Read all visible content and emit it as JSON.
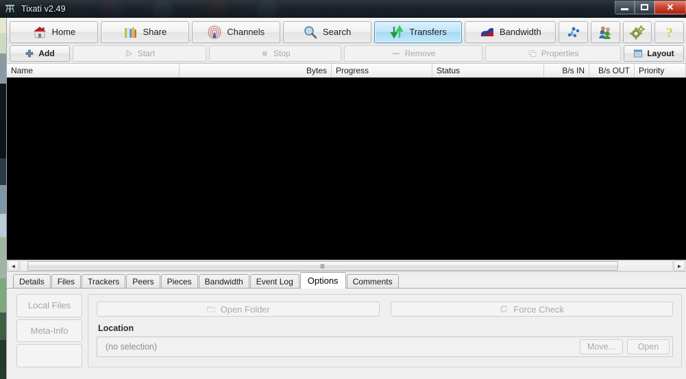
{
  "window": {
    "title": "Tixati v2.49",
    "app_icon": "tixati-logo-icon",
    "controls": {
      "minimize": "–",
      "maximize": "□",
      "close": "✕"
    }
  },
  "main_toolbar": {
    "items": [
      {
        "label": "Home",
        "icon": "house-icon",
        "selected": false
      },
      {
        "label": "Share",
        "icon": "books-icon",
        "selected": false
      },
      {
        "label": "Channels",
        "icon": "antenna-icon",
        "selected": false
      },
      {
        "label": "Search",
        "icon": "magnifier-icon",
        "selected": false
      },
      {
        "label": "Transfers",
        "icon": "up-down-arrows-icon",
        "selected": true
      },
      {
        "label": "Bandwidth",
        "icon": "wave-graph-icon",
        "selected": false
      }
    ],
    "icon_buttons": [
      {
        "icon": "network-nodes-icon",
        "label": ""
      },
      {
        "icon": "peers-people-icon",
        "label": ""
      },
      {
        "icon": "gears-settings-icon",
        "label": ""
      },
      {
        "icon": "question-mark-help-icon",
        "label": ""
      }
    ]
  },
  "action_bar": {
    "buttons": [
      {
        "label": "Add",
        "icon": "plus-icon",
        "enabled": true
      },
      {
        "label": "Start",
        "icon": "play-triangle-icon",
        "enabled": false
      },
      {
        "label": "Stop",
        "icon": "stop-square-icon",
        "enabled": false
      },
      {
        "label": "Remove",
        "icon": "minus-icon",
        "enabled": false
      },
      {
        "label": "Properties",
        "icon": "windows-copy-icon",
        "enabled": false
      },
      {
        "label": "Layout",
        "icon": "layout-panel-icon",
        "enabled": true
      }
    ]
  },
  "transfer_list": {
    "columns": [
      {
        "label": "Name",
        "align": "left"
      },
      {
        "label": "Bytes",
        "align": "right"
      },
      {
        "label": "Progress",
        "align": "left"
      },
      {
        "label": "Status",
        "align": "left"
      },
      {
        "label": "B/s IN",
        "align": "right"
      },
      {
        "label": "B/s OUT",
        "align": "right"
      },
      {
        "label": "Priority",
        "align": "left"
      }
    ],
    "rows": [],
    "empty": true,
    "background_color": "#000000"
  },
  "scrollbar": {
    "left_arrow": "◄",
    "right_arrow": "►",
    "grip": "|||"
  },
  "detail_tabs": {
    "items": [
      {
        "label": "Details",
        "active": false
      },
      {
        "label": "Files",
        "active": false
      },
      {
        "label": "Trackers",
        "active": false
      },
      {
        "label": "Peers",
        "active": false
      },
      {
        "label": "Pieces",
        "active": false
      },
      {
        "label": "Bandwidth",
        "active": false
      },
      {
        "label": "Event Log",
        "active": false
      },
      {
        "label": "Options",
        "active": true
      },
      {
        "label": "Comments",
        "active": false
      }
    ]
  },
  "options_panel": {
    "side_buttons": [
      {
        "label": "Local Files",
        "enabled": false
      },
      {
        "label": "Meta-Info",
        "enabled": false
      },
      {
        "label": "",
        "enabled": false
      }
    ],
    "action_buttons": [
      {
        "label": "Open Folder",
        "icon": "folder-icon",
        "enabled": false
      },
      {
        "label": "Force Check",
        "icon": "refresh-icon",
        "enabled": false
      }
    ],
    "location": {
      "label": "Location",
      "value": "(no selection)",
      "buttons": [
        {
          "label": "Move...",
          "enabled": false
        },
        {
          "label": "Open",
          "enabled": false
        }
      ]
    }
  },
  "colors": {
    "accent_selected_tab": "#a6d8f3",
    "close_button": "#cf4a36",
    "list_background": "#000000",
    "chrome": "#f0f0f0"
  }
}
